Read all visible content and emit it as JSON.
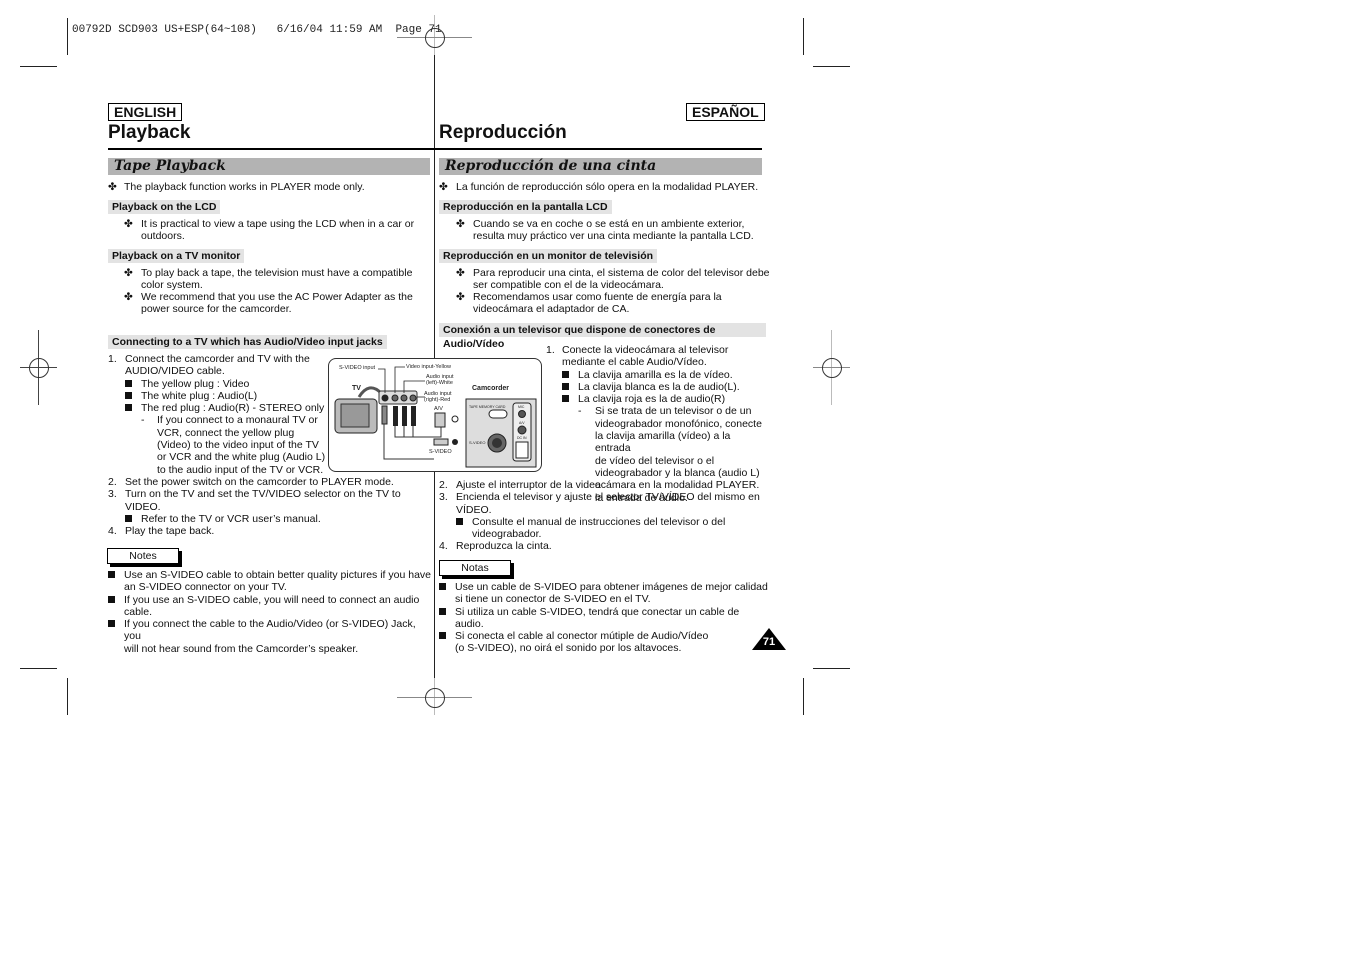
{
  "slug": "00792D SCD903 US+ESP(64~108)   6/16/04 11:59 AM  Page 71",
  "page_number": "71",
  "english": {
    "lang_label": "ENGLISH",
    "title": "Playback",
    "section": "Tape Playback",
    "intro": "The playback function works in PLAYER mode only.",
    "lcd": {
      "heading": "Playback on the LCD",
      "bullets": [
        "It is practical to view a tape using the LCD when in a car or",
        "outdoors."
      ]
    },
    "tv": {
      "heading": "Playback on a TV monitor",
      "bullet1": [
        "To play back a tape, the television must have a compatible",
        "color system."
      ],
      "bullet2": [
        "We recommend that you use the AC Power Adapter as the",
        "power source for the camcorder."
      ]
    },
    "connect": {
      "heading": "Connecting to a TV which has Audio/Video input jacks",
      "step1": [
        "1.",
        "Connect the camcorder and TV with the",
        "AUDIO/VIDEO cable."
      ],
      "plugs": [
        "The yellow plug : Video",
        "The white plug : Audio(L)",
        "The red plug : Audio(R) - STEREO only"
      ],
      "mono_note": [
        "If you connect to a monaural TV or",
        "VCR, connect the yellow plug",
        "(Video) to the video input of the TV",
        "or VCR and the white plug (Audio L)",
        "to the audio input of the TV or VCR."
      ],
      "step2": [
        "2.",
        "Set the power switch on the camcorder to PLAYER mode."
      ],
      "step3": [
        "3.",
        "Turn on the TV and set the TV/VIDEO selector on the TV to",
        "VIDEO."
      ],
      "step3_sub": "Refer to the TV or VCR user’s manual.",
      "step4": [
        "4.",
        "Play the tape back."
      ]
    },
    "notes_label": "Notes",
    "notes": [
      [
        "Use an S-VIDEO cable to obtain better quality pictures if you have",
        "an S-VIDEO connector on your TV."
      ],
      [
        "If you use an S-VIDEO cable, you will need to connect an audio",
        "cable."
      ],
      [
        "If you connect the cable to the Audio/Video (or S-VIDEO) Jack, you",
        "will not hear sound from the Camcorder’s speaker."
      ]
    ]
  },
  "spanish": {
    "lang_label": "ESPAÑOL",
    "title": "Reproducción",
    "section": "Reproducción de una cinta",
    "intro": "La función de reproducción sólo opera en la modalidad PLAYER.",
    "lcd": {
      "heading": "Reproducción en la pantalla LCD",
      "bullets": [
        "Cuando se va en coche o se está en un ambiente exterior,",
        "resulta muy práctico ver una cinta mediante la pantalla LCD."
      ]
    },
    "tv": {
      "heading": "Reproducción en un monitor de televisión",
      "bullet1": [
        "Para reproducir una cinta, el sistema de color del televisor debe",
        "ser compatible con el de la videocámara."
      ],
      "bullet2": [
        "Recomendamos usar como fuente de energía para la",
        "videocámara el adaptador de CA."
      ]
    },
    "connect": {
      "heading": "Conexión a un televisor que dispone de conectores de Audio/Vídeo",
      "step1": [
        "1.",
        "Conecte la videocámara al televisor",
        "mediante el cable Audio/Vídeo."
      ],
      "plugs": [
        "La clavija amarilla es la de vídeo.",
        "La clavija blanca es la de audio(L).",
        "La clavija roja es la de  audio(R)"
      ],
      "mono_note": [
        "Si se trata de un televisor o de un",
        "videograbador monofónico, conecte",
        "la clavija amarilla (vídeo) a la entrada",
        "de vídeo del televisor o el",
        "videograbador y la blanca (audio L) a",
        "la entrada de audio."
      ],
      "step2": [
        "2.",
        "Ajuste el interruptor de la videocámara en la modalidad PLAYER."
      ],
      "step3": [
        "3.",
        "Encienda el televisor y ajuste el selector TV/VÍDEO del mismo en",
        "VÍDEO."
      ],
      "step3_sub": [
        "Consulte el manual de instrucciones del televisor o del",
        "videograbador."
      ],
      "step4": [
        "4.",
        "Reproduzca la cinta."
      ]
    },
    "notes_label": "Notas",
    "notes": [
      [
        "Use un cable de S-VIDEO para obtener imágenes de mejor calidad",
        "si tiene un conector de S-VIDEO en el TV."
      ],
      [
        "Si utiliza un cable S-VIDEO, tendrá que conectar un cable de audio."
      ],
      [
        "Si conecta el cable al conector mútiple de Audio/Vídeo",
        "(o S-VIDEO), no oirá el sonido por los altavoces."
      ]
    ]
  },
  "diagram": {
    "tv_label": "TV",
    "camcorder_label": "Camcorder",
    "svideo_input": "S-VIDEO input",
    "video_input": "Video input-Yellow",
    "audio_left": [
      "Audio input",
      "(left)-White"
    ],
    "audio_right": [
      "Audio input",
      "(right)-Red"
    ],
    "av_label": "A/V",
    "svideo_cable": "S-VIDEO",
    "cam_svideo": "S-VIDEO",
    "cam_mic": "MIC",
    "cam_av": "A/V",
    "cam_dcin": "DC IN",
    "cam_switch": "TAPE MEMORY CARD"
  }
}
